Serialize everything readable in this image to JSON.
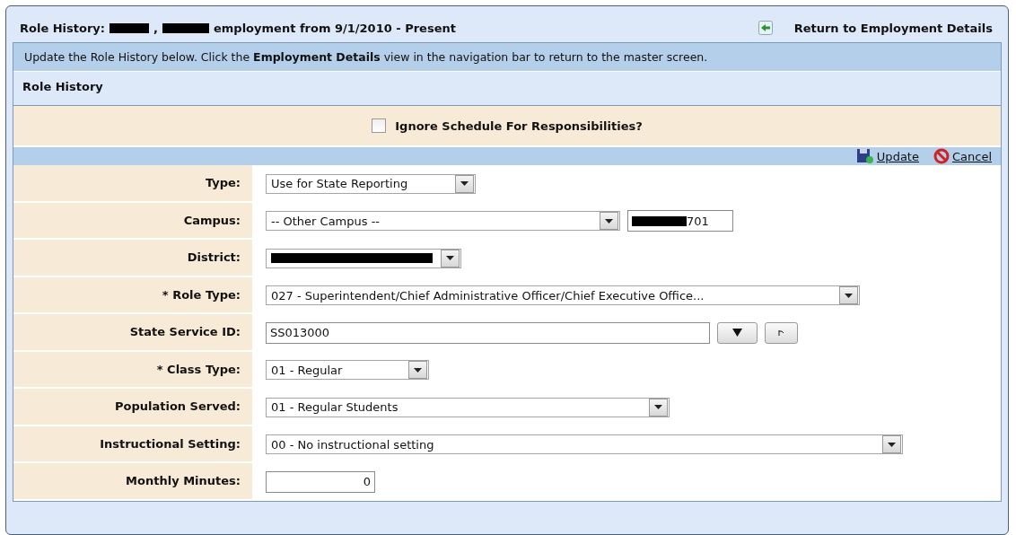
{
  "header": {
    "title": [
      {
        "kind": "text",
        "text": "Role History:"
      },
      {
        "kind": "redacted"
      },
      {
        "kind": "text",
        "text": ","
      },
      {
        "kind": "redacted"
      },
      {
        "kind": "text",
        "text": "employment from 9/1/2010 - Present"
      }
    ],
    "return_link": "Return to Employment Details"
  },
  "info": {
    "before": "Update the Role History below. Click the",
    "bold": "Employment Details",
    "after": "view in the navigation bar to return to the master screen."
  },
  "section_title": "Role History",
  "ignore_schedule": {
    "label": "Ignore Schedule For Responsibilities?",
    "checked": false
  },
  "actions": [
    "Update",
    "Cancel"
  ],
  "fields": [
    {
      "kind": "select",
      "label": "Type:",
      "value": "Use for State Reporting"
    },
    {
      "kind": "select_code",
      "label": "Campus:",
      "value": "-- Other Campus --",
      "code": "701"
    },
    {
      "kind": "select_redacted",
      "label": "District:"
    },
    {
      "kind": "select",
      "label": "* Role Type:",
      "value": "027 - Superintendent/Chief Administrative Officer/Chief Executive Office..."
    },
    {
      "kind": "input_buttons",
      "label": "State Service ID:",
      "value": "SS013000"
    },
    {
      "kind": "select",
      "label": "* Class Type:",
      "value": "01 - Regular"
    },
    {
      "kind": "select",
      "label": "Population Served:",
      "value": "01 - Regular Students"
    },
    {
      "kind": "select",
      "label": "Instructional Setting:",
      "value": "00 - No instructional setting"
    },
    {
      "kind": "number",
      "label": "Monthly Minutes:",
      "value": "0"
    }
  ]
}
